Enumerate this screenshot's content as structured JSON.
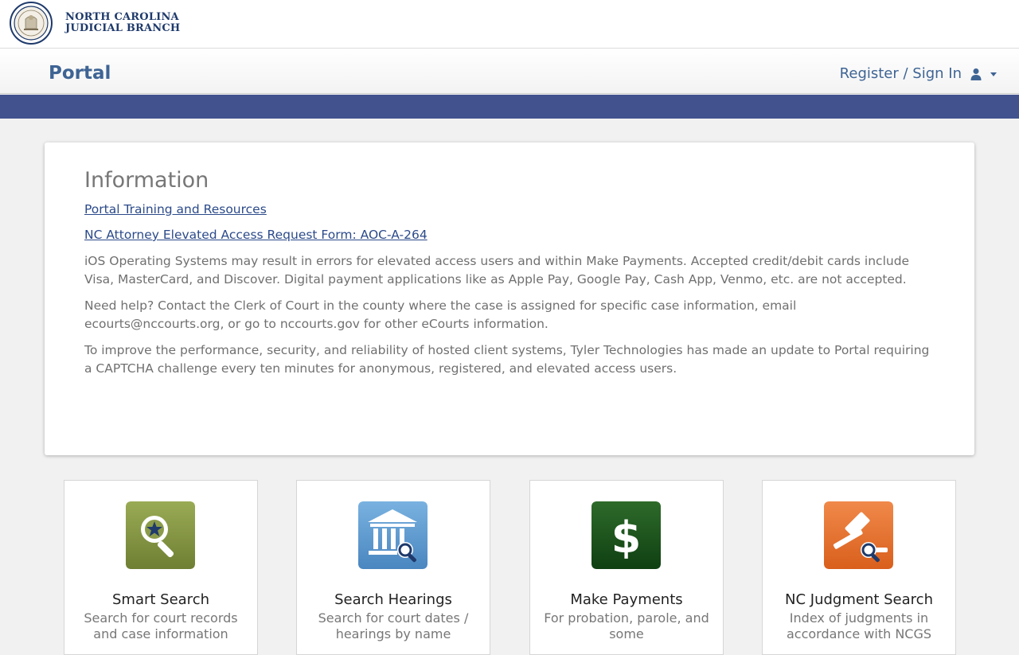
{
  "brand": {
    "line1": "NORTH CAROLINA",
    "line2": "JUDICIAL BRANCH"
  },
  "nav": {
    "title": "Portal",
    "signin_label": "Register / Sign In"
  },
  "info": {
    "heading": "Information",
    "links": [
      "Portal Training and Resources",
      "NC Attorney Elevated Access Request Form: AOC-A-264"
    ],
    "paragraphs": [
      "iOS Operating Systems may result in errors for elevated access users and within Make Payments. Accepted credit/debit cards include Visa, MasterCard, and Discover. Digital payment applications like as Apple Pay, Google Pay, Cash App, Venmo, etc. are not accepted.",
      "Need help? Contact the Clerk of Court in the county where the case is assigned for specific case information, email ecourts@nccourts.org, or go to nccourts.gov for other eCourts information.",
      "To improve the performance, security, and reliability of hosted client systems, Tyler Technologies has made an update to Portal requiring a CAPTCHA challenge every ten minutes for anonymous, registered, and elevated access users."
    ]
  },
  "tiles": [
    {
      "title": "Smart Search",
      "desc": "Search for court records and case information",
      "icon": "magnifier-star-icon",
      "color": "#8b9b4a"
    },
    {
      "title": "Search Hearings",
      "desc": "Search for court dates / hearings by name",
      "icon": "courthouse-search-icon",
      "color": "#5b9ad0"
    },
    {
      "title": "Make Payments",
      "desc": "For probation, parole, and some",
      "icon": "dollar-icon",
      "color": "#1e5a1e"
    },
    {
      "title": "NC Judgment Search",
      "desc": "Index of judgments in accordance with NCGS",
      "icon": "gavel-search-icon",
      "color": "#e8742e"
    }
  ],
  "colors": {
    "accent_band": "#41528e",
    "link": "#2b4a8a",
    "portal_title": "#3e6494"
  }
}
